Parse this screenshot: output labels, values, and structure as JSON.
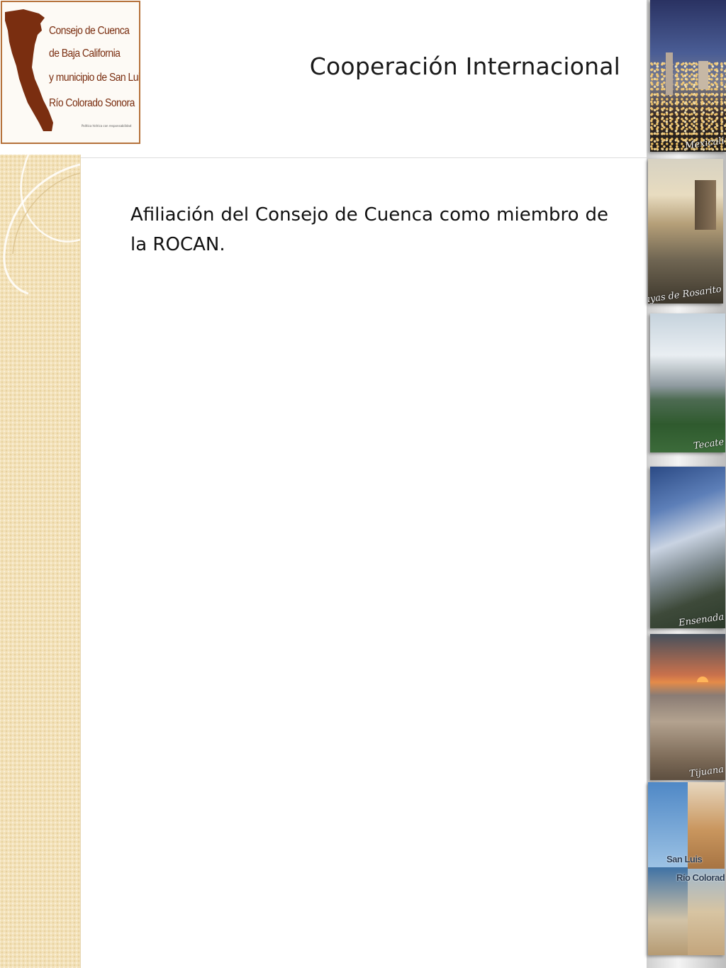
{
  "header": {
    "logo": {
      "lines": [
        "Consejo de Cuenca",
        "de Baja California",
        "y municipio de San Luis",
        "Río Colorado Sonora"
      ],
      "tagline": "Política hídrica con responsabilidad",
      "brand_color": "#7a2e10"
    },
    "title": "Cooperación Internacional"
  },
  "content": {
    "paragraph": "Afiliación del Consejo de Cuenca como miembro de la ROCAN."
  },
  "photo_strip": [
    {
      "caption": "Mexicali"
    },
    {
      "caption": "Playas de Rosarito"
    },
    {
      "caption": "Tecate"
    },
    {
      "caption": "Ensenada"
    },
    {
      "caption": "Tijuana"
    },
    {
      "caption_line1": "San Luis",
      "caption_line2": "Río Colorado"
    }
  ]
}
